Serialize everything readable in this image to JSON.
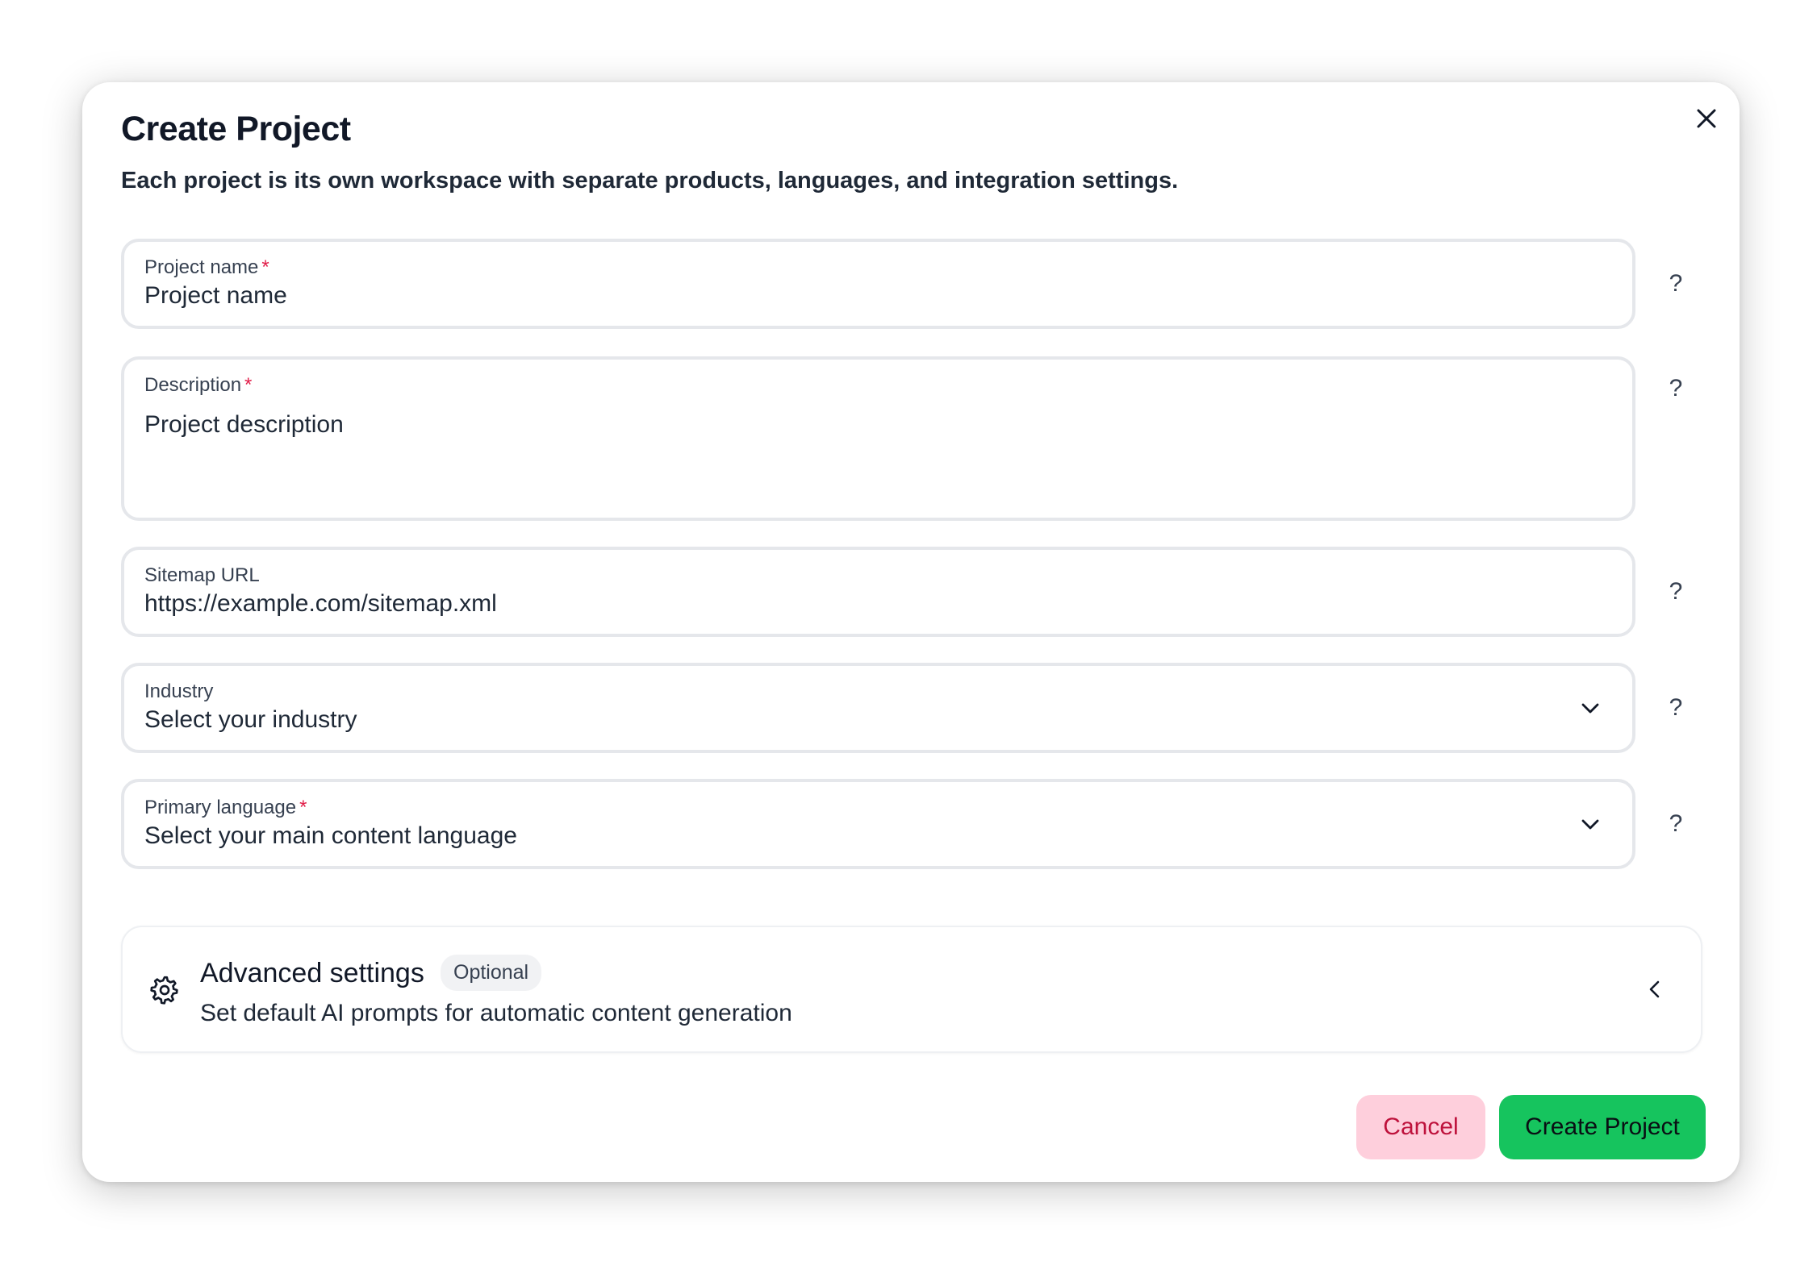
{
  "dialog": {
    "title": "Create Project",
    "subtitle": "Each project is its own workspace with separate products, languages, and integration settings.",
    "close_icon": "close-icon"
  },
  "fields": {
    "project_name": {
      "label": "Project name",
      "required_mark": "*",
      "placeholder": "Project name",
      "help": "?"
    },
    "description": {
      "label": "Description",
      "required_mark": "*",
      "placeholder": "Project description",
      "help": "?"
    },
    "sitemap_url": {
      "label": "Sitemap URL",
      "placeholder": "https://example.com/sitemap.xml",
      "help": "?"
    },
    "industry": {
      "label": "Industry",
      "selected": "Select your industry",
      "icon": "chevron-down-icon",
      "help": "?"
    },
    "primary_language": {
      "label": "Primary language",
      "required_mark": "*",
      "selected": "Select your main content language",
      "icon": "chevron-down-icon",
      "help": "?"
    }
  },
  "advanced": {
    "title": "Advanced settings",
    "badge": "Optional",
    "description": "Set default AI prompts for automatic content generation",
    "icon": "gear-icon",
    "toggle_icon": "chevron-left-icon"
  },
  "actions": {
    "cancel_label": "Cancel",
    "create_label": "Create Project"
  },
  "colors": {
    "required": "#e11d48",
    "cancel_bg": "#fecfdc",
    "cancel_text": "#be123c",
    "create_bg": "#16c45e"
  }
}
